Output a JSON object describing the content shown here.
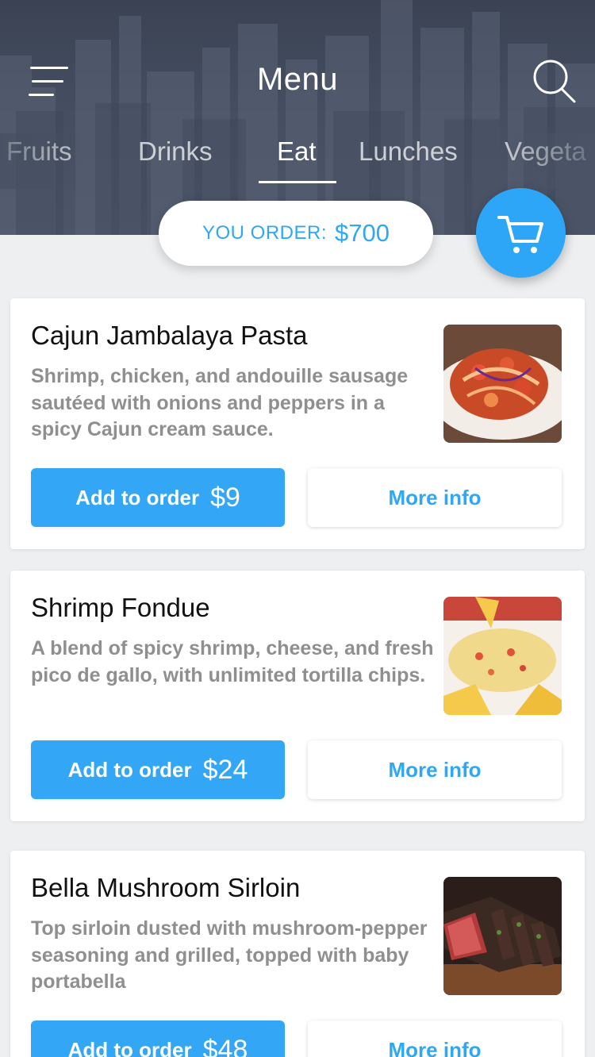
{
  "header": {
    "title": "Menu",
    "tabs": [
      {
        "label": "Fruits"
      },
      {
        "label": "Drinks"
      },
      {
        "label": "Eat",
        "active": true
      },
      {
        "label": "Lunches"
      },
      {
        "label": "Vegeta"
      }
    ]
  },
  "order": {
    "label": "YOU ORDER:",
    "amount": "$700"
  },
  "colors": {
    "accent": "#2ea8f5",
    "header_bg": "#454e61",
    "page_bg": "#eeeff1"
  },
  "icons": [
    "hamburger-menu-icon",
    "search-icon",
    "cart-icon"
  ],
  "items": [
    {
      "name": "Cajun Jambalaya Pasta",
      "description": "Shrimp, chicken, and andouille sausage sautéed with onions and peppers in a spicy Cajun cream sauce.",
      "add_label": "Add to order",
      "price": "$9",
      "info_label": "More info"
    },
    {
      "name": "Shrimp Fondue",
      "description": "A blend of spicy shrimp, cheese, and fresh pico de gallo, with unlimited tortilla chips.",
      "add_label": "Add to order",
      "price": "$24",
      "info_label": "More info"
    },
    {
      "name": "Bella Mushroom Sirloin",
      "description": "Top sirloin dusted with mushroom-pepper seasoning and grilled, topped with baby portabella",
      "add_label": "Add to order",
      "price": "$48",
      "info_label": "More info"
    }
  ]
}
